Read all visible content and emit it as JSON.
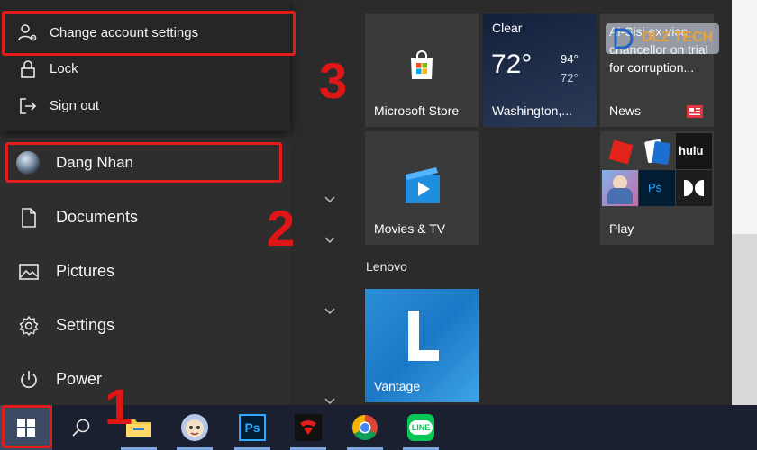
{
  "account_popup": {
    "items": [
      {
        "label": "Change account settings",
        "icon": "person-gear-icon"
      },
      {
        "label": "Lock",
        "icon": "lock-icon"
      },
      {
        "label": "Sign out",
        "icon": "sign-out-icon"
      }
    ]
  },
  "user": {
    "name": "Dang Nhan"
  },
  "nav": [
    {
      "label": "Documents",
      "icon": "document-icon"
    },
    {
      "label": "Pictures",
      "icon": "pictures-icon"
    },
    {
      "label": "Settings",
      "icon": "gear-icon"
    },
    {
      "label": "Power",
      "icon": "power-icon"
    }
  ],
  "tiles": {
    "store": {
      "label": "Microsoft Store"
    },
    "weather": {
      "condition": "Clear",
      "temp": "72°",
      "high": "94°",
      "low": "72°",
      "city": "Washington,..."
    },
    "news": {
      "headline": "Al-Sisi ex vice chancellor on trial for corruption...",
      "label": "News"
    },
    "movies": {
      "label": "Movies & TV"
    },
    "play": {
      "label": "Play"
    },
    "vantage": {
      "label": "Vantage"
    }
  },
  "groups": {
    "lenovo": "Lenovo"
  },
  "play_apps": [
    "hulu",
    "Ps"
  ],
  "steps": [
    "1",
    "2",
    "3"
  ],
  "watermark": {
    "text": "DLZ TECH"
  },
  "colors": {
    "highlight": "#e21b1b",
    "tile_blue": "#1b78c7",
    "weather_bg": "#1d2a45"
  },
  "taskbar": [
    "start-button",
    "search-button",
    "file-explorer",
    "app-avatar",
    "photoshop",
    "garena",
    "chrome",
    "line"
  ],
  "taskbar_labels": {
    "photoshop": "Ps",
    "line": "LINE"
  }
}
